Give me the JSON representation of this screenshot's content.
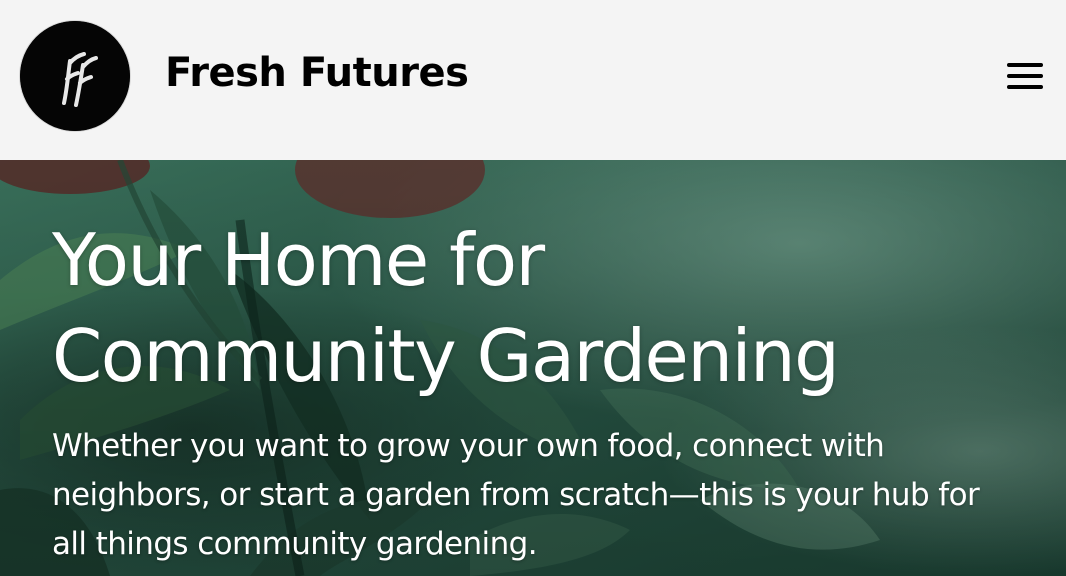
{
  "header": {
    "logo": {
      "icon": "fresh-futures-logo",
      "monogram": "FF"
    },
    "brand_name": "Fresh Futures",
    "menu_icon": "hamburger-menu-icon"
  },
  "hero": {
    "title_line1": "Your Home for",
    "title_line2": "Community Gardening",
    "subtitle": "Whether you want to grow your own food, connect with neighbors, or start a garden from scratch—this is your hub for all things community gardening.",
    "background": "photo-of-hands-tending-green-plants"
  },
  "colors": {
    "header_bg": "#f4f4f4",
    "brand_text": "#000000",
    "hero_text": "#ffffff",
    "hero_overlay": "#2f5f50"
  }
}
